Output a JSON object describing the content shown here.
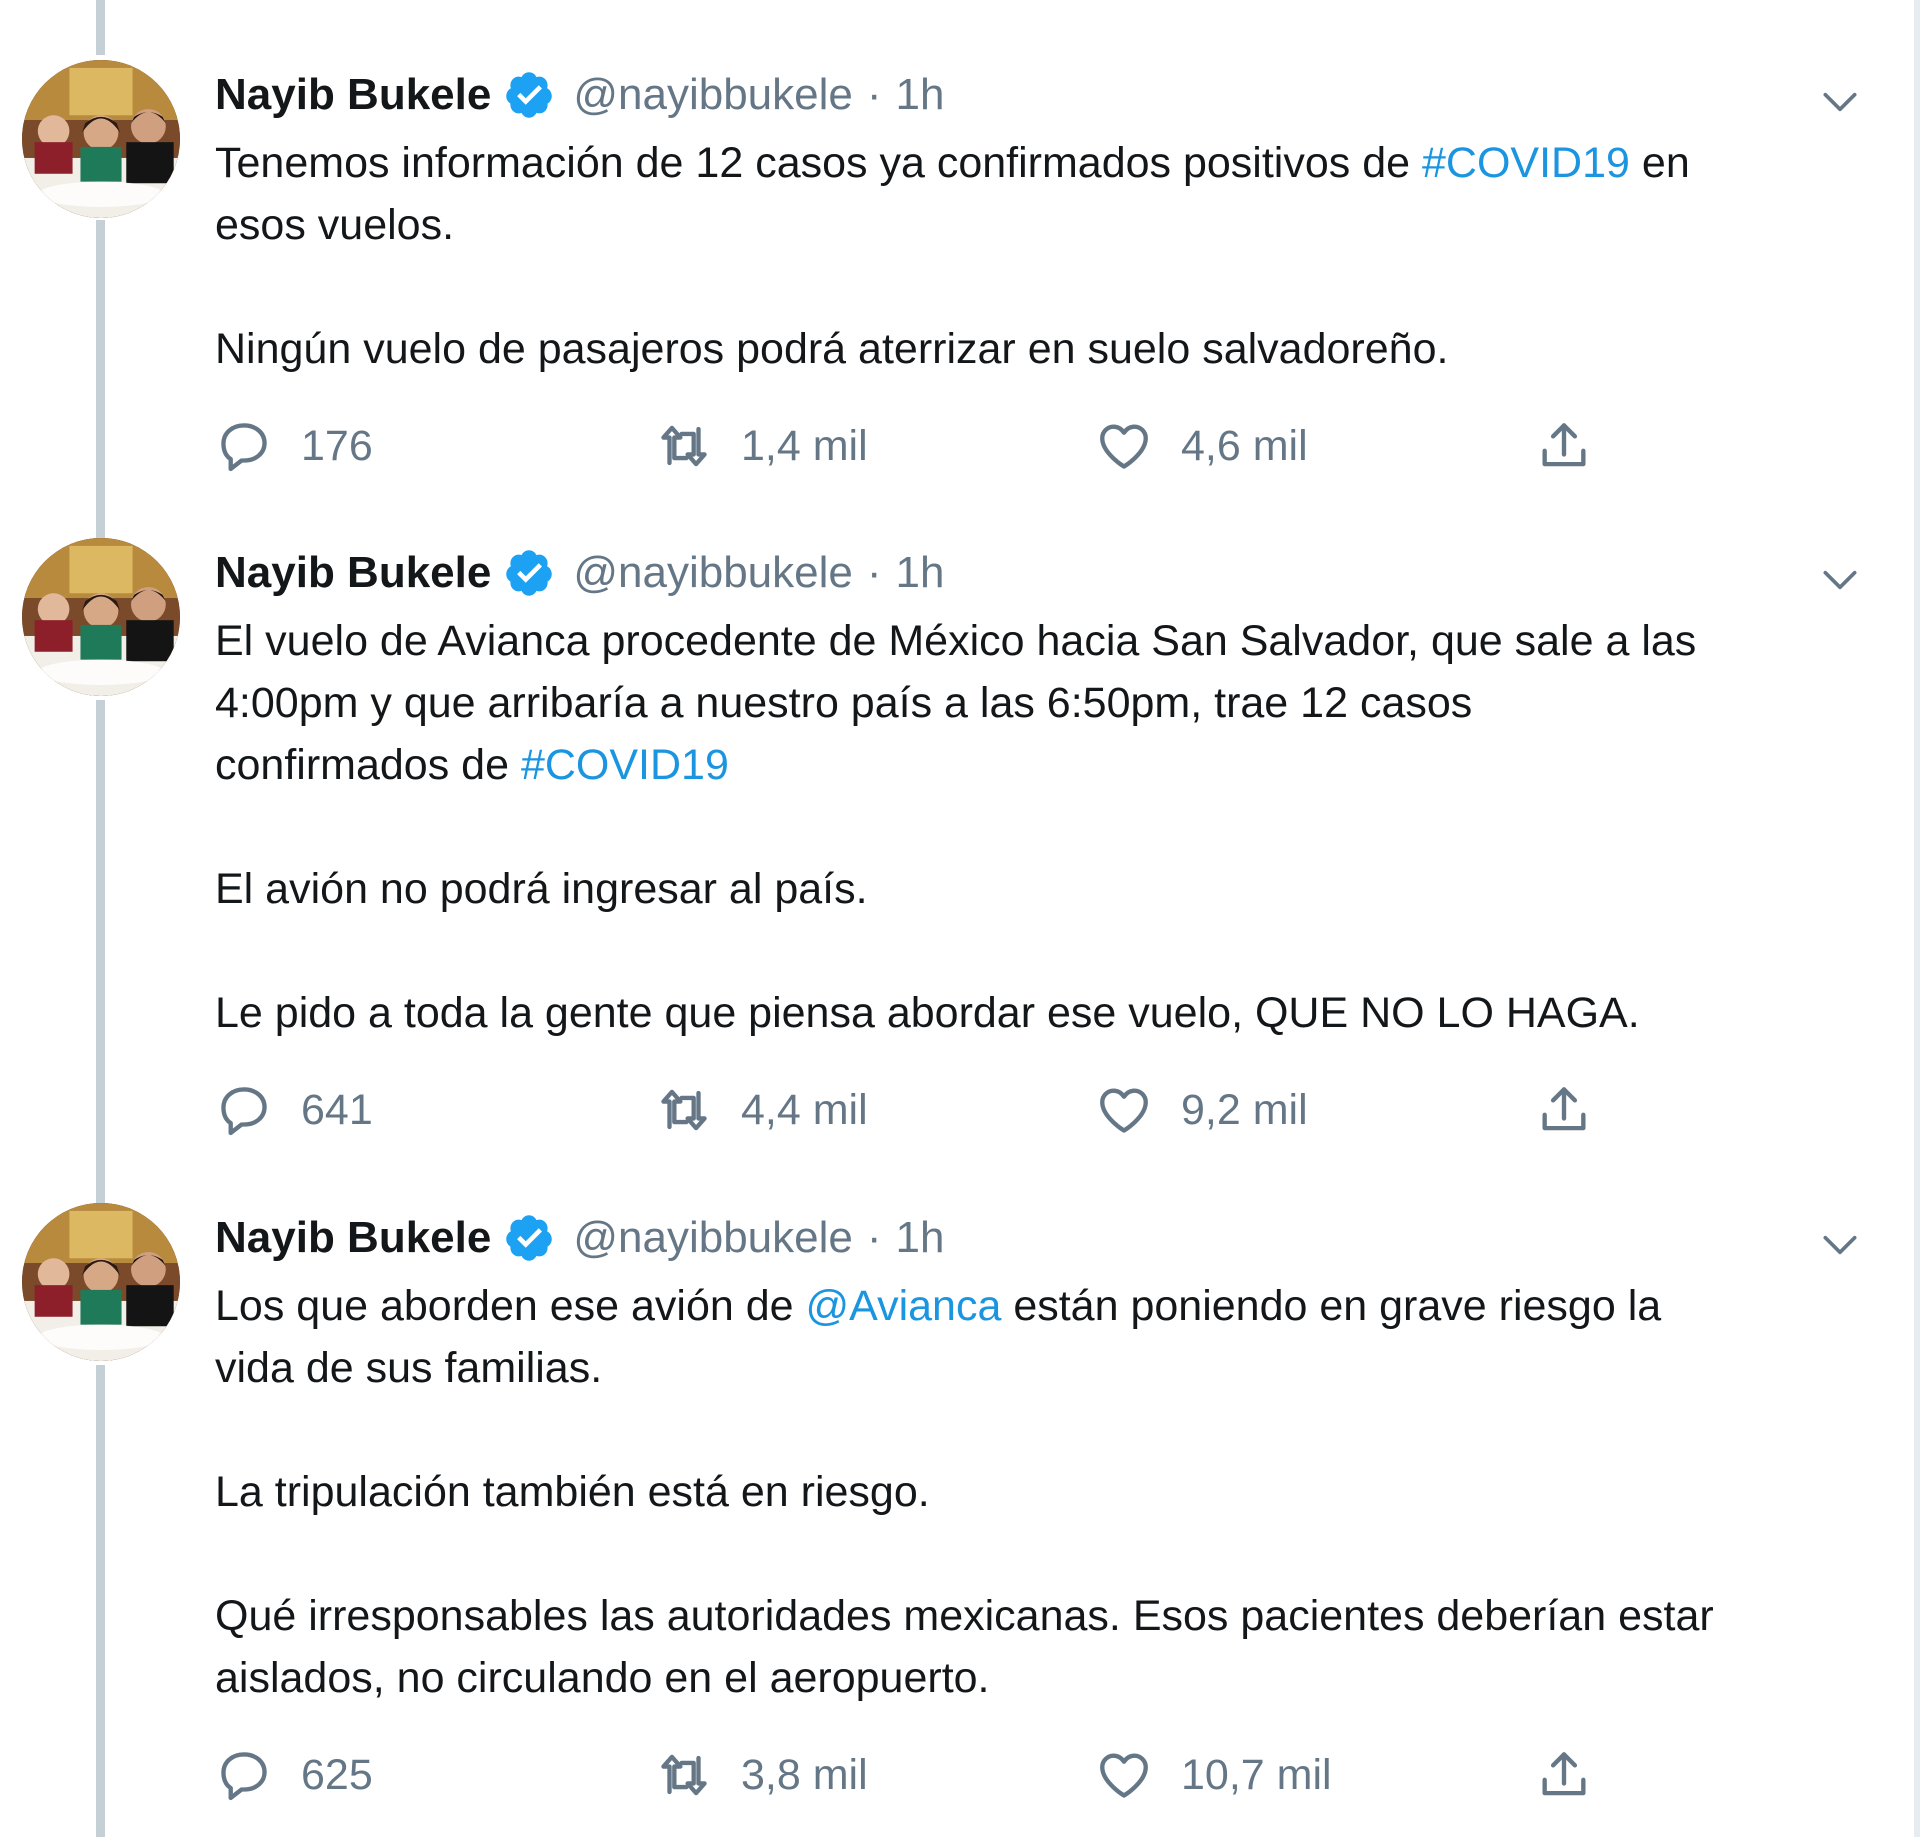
{
  "colors": {
    "link": "#1b95e0",
    "verified": "#1da1f2",
    "muted": "#657786",
    "thread_line": "#c4cfd6"
  },
  "icons": {
    "verified": "verified-badge-icon",
    "caret": "chevron-down-icon",
    "reply": "reply-icon",
    "retweet": "retweet-icon",
    "like": "heart-icon",
    "share": "share-icon"
  },
  "tweets": [
    {
      "name": "Nayib Bukele",
      "handle": "@nayibbukele",
      "separator": "·",
      "time": "1h",
      "lines": [
        {
          "pre": "Tenemos información de 12 casos ya confirmados positivos de ",
          "link": "#COVID19",
          "post": " en"
        },
        {
          "pre": "esos vuelos.",
          "link": "",
          "post": ""
        },
        {
          "gap": true
        },
        {
          "pre": "Ningún vuelo de pasajeros podrá aterrizar en suelo salvadoreño.",
          "link": "",
          "post": ""
        }
      ],
      "replies": "176",
      "retweets": "1,4 mil",
      "likes": "4,6 mil"
    },
    {
      "name": "Nayib Bukele",
      "handle": "@nayibbukele",
      "separator": "·",
      "time": "1h",
      "lines": [
        {
          "pre": "El vuelo de Avianca procedente de México hacia San Salvador, que sale a las",
          "link": "",
          "post": ""
        },
        {
          "pre": "4:00pm y que arribaría a nuestro país a las 6:50pm, trae 12 casos",
          "link": "",
          "post": ""
        },
        {
          "pre": "confirmados de ",
          "link": "#COVID19",
          "post": ""
        },
        {
          "gap": true
        },
        {
          "pre": "El avión no podrá ingresar al país.",
          "link": "",
          "post": ""
        },
        {
          "gap": true
        },
        {
          "pre": "Le pido a toda la gente que piensa abordar ese vuelo, QUE NO LO HAGA.",
          "link": "",
          "post": ""
        }
      ],
      "replies": "641",
      "retweets": "4,4 mil",
      "likes": "9,2 mil"
    },
    {
      "name": "Nayib Bukele",
      "handle": "@nayibbukele",
      "separator": "·",
      "time": "1h",
      "lines": [
        {
          "pre": "Los que aborden ese avión de ",
          "link": "@Avianca",
          "post": " están poniendo en grave riesgo la"
        },
        {
          "pre": "vida de sus familias.",
          "link": "",
          "post": ""
        },
        {
          "gap": true
        },
        {
          "pre": "La tripulación también está en riesgo.",
          "link": "",
          "post": ""
        },
        {
          "gap": true
        },
        {
          "pre": "Qué irresponsables las autoridades mexicanas. Esos pacientes deberían estar",
          "link": "",
          "post": ""
        },
        {
          "pre": "aislados, no circulando en el aeropuerto.",
          "link": "",
          "post": ""
        }
      ],
      "replies": "625",
      "retweets": "3,8 mil",
      "likes": "10,7 mil"
    }
  ]
}
